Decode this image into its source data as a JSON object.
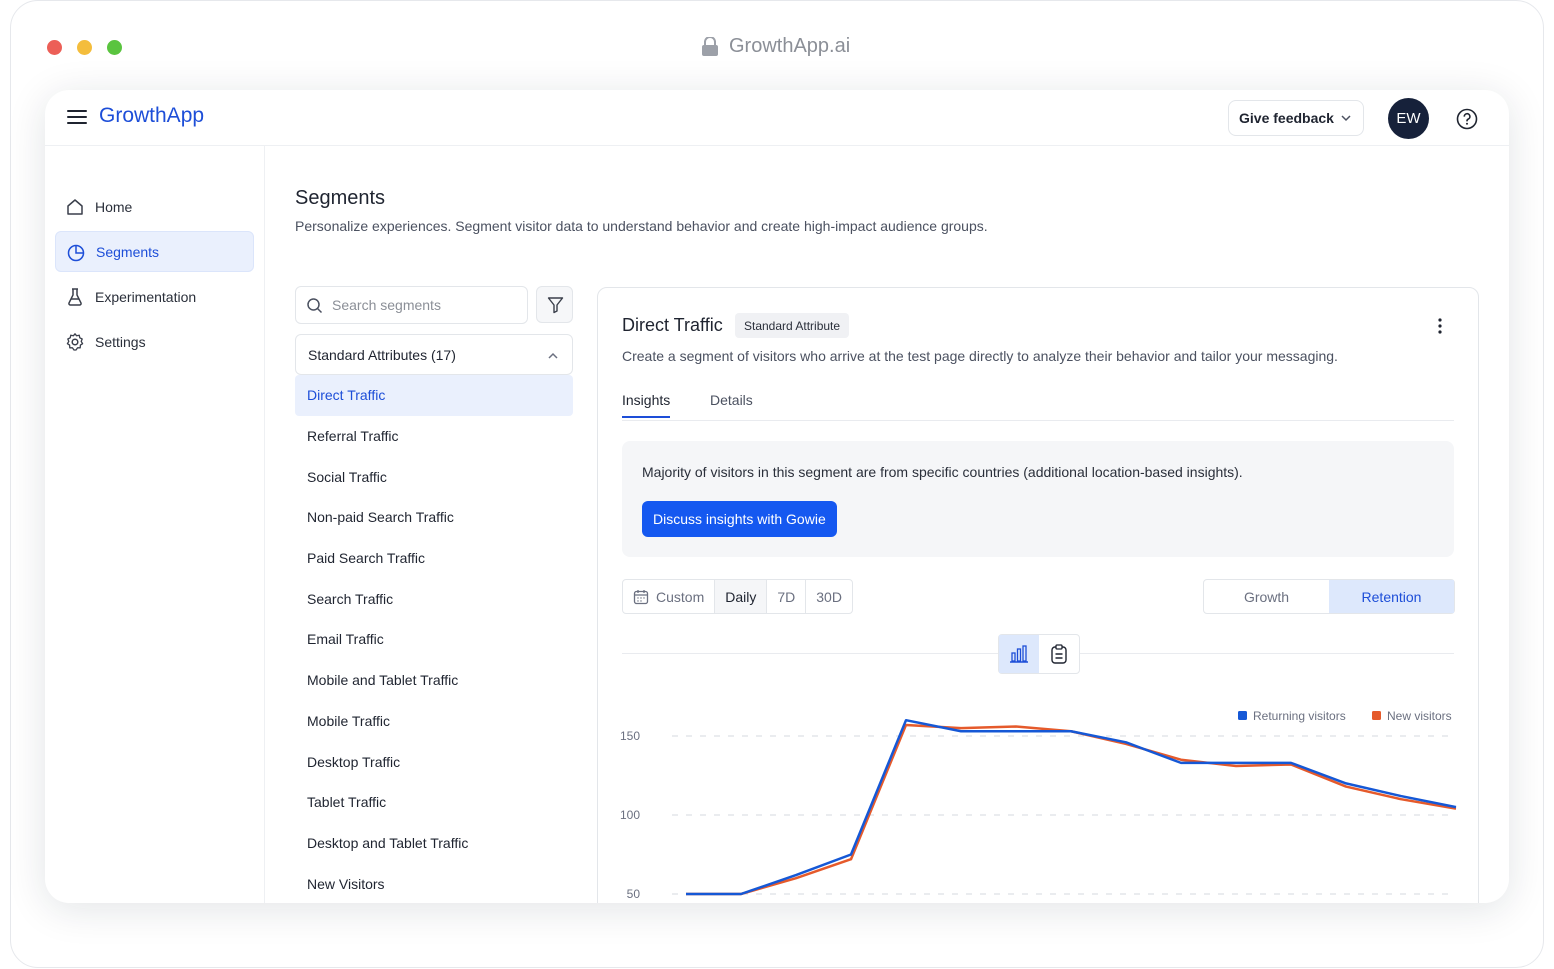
{
  "browser": {
    "url": "GrowthApp.ai"
  },
  "header": {
    "logo": "GrowthApp",
    "feedback_label": "Give feedback",
    "avatar_initials": "EW"
  },
  "sidebar": {
    "items": [
      {
        "label": "Home",
        "icon": "home-icon"
      },
      {
        "label": "Segments",
        "icon": "pie-chart-icon",
        "active": true
      },
      {
        "label": "Experimentation",
        "icon": "flask-icon"
      },
      {
        "label": "Settings",
        "icon": "gear-icon"
      }
    ]
  },
  "page": {
    "title": "Segments",
    "subtitle": "Personalize experiences. Segment visitor data to understand behavior and create high-impact audience groups."
  },
  "segments": {
    "search_placeholder": "Search segments",
    "group_label": "Standard Attributes (17)",
    "items": [
      "Direct Traffic",
      "Referral Traffic",
      "Social Traffic",
      "Non-paid Search Traffic",
      "Paid Search Traffic",
      "Search Traffic",
      "Email Traffic",
      "Mobile and Tablet Traffic",
      "Mobile Traffic",
      "Desktop Traffic",
      "Tablet Traffic",
      "Desktop and Tablet Traffic",
      "New Visitors"
    ],
    "active_index": 0
  },
  "detail": {
    "title": "Direct Traffic",
    "badge": "Standard Attribute",
    "description": "Create a segment of visitors who arrive at the test page directly to analyze their behavior and tailor your messaging.",
    "tabs": [
      "Insights",
      "Details"
    ],
    "insight_text": "Majority of visitors in this segment are from specific countries (additional location-based insights).",
    "insight_button": "Discuss insights with Gowie",
    "range_options": [
      "Custom",
      "Daily",
      "7D",
      "30D"
    ],
    "range_active": "Daily",
    "mode_options": [
      "Growth",
      "Retention"
    ],
    "mode_active": "Retention"
  },
  "chart_data": {
    "type": "line",
    "y_ticks": [
      150,
      100,
      50
    ],
    "ylim": [
      50,
      150
    ],
    "grid": true,
    "legend_position": "top-right",
    "series": [
      {
        "name": "Returning visitors",
        "color": "#1558d6",
        "x": [
          0,
          1,
          2,
          3,
          4,
          5,
          6,
          7,
          8,
          9,
          10,
          11,
          12,
          13,
          14
        ],
        "values": [
          50,
          50,
          62,
          75,
          160,
          153,
          153,
          153,
          146,
          133,
          133,
          133,
          120,
          112,
          105
        ]
      },
      {
        "name": "New visitors",
        "color": "#e55a2b",
        "x": [
          0,
          1,
          2,
          3,
          4,
          5,
          6,
          7,
          8,
          9,
          10,
          11,
          12,
          13,
          14
        ],
        "values": [
          50,
          50,
          60,
          72,
          157,
          155,
          156,
          153,
          145,
          135,
          131,
          132,
          118,
          110,
          104
        ]
      }
    ]
  }
}
